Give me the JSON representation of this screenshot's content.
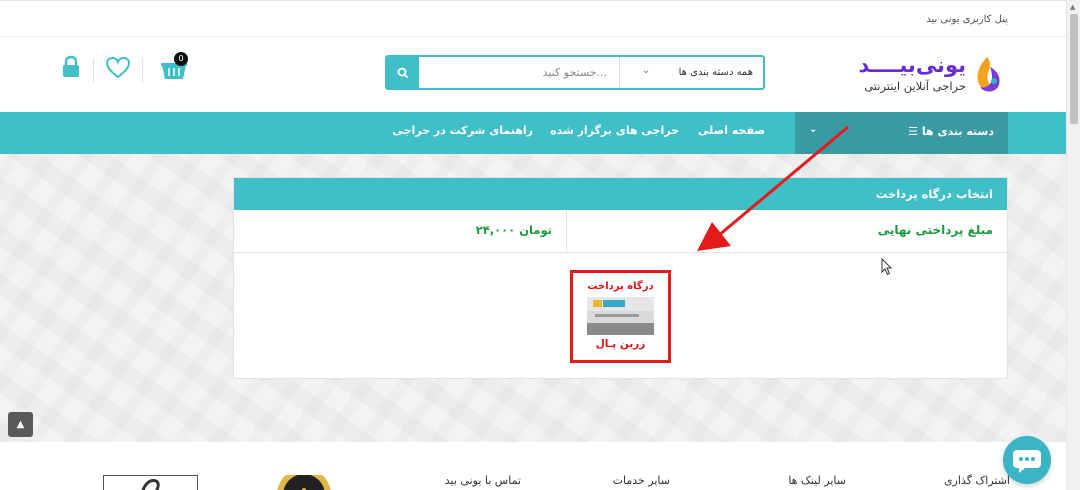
{
  "topbar": {
    "user_panel": "پنل کاربری یونی بید"
  },
  "header": {
    "logo_brand": "یونی‌بیــــد",
    "logo_tagline": "حراجی آنلاین اینترنتی",
    "search": {
      "category": "همه دسته بندی ها",
      "placeholder": "جستجو کنید..."
    },
    "cart_count": "0",
    "icons": [
      "search-icon",
      "cart-icon",
      "heart-icon",
      "lock-icon"
    ]
  },
  "nav": {
    "categories": "دسته بندی ها",
    "links": [
      "صفحه اصلی",
      "حراجی های برگزار شده",
      "راهنمای شرکت در حراجی"
    ]
  },
  "payment": {
    "title": "انتخاب درگاه پرداخت",
    "amount_label": "مبلغ پرداختی نهایی",
    "amount_value": "۲۴,۰۰۰ تومان",
    "gateway_title": "درگاه پرداخت",
    "gateway_name": "زرین پـال"
  },
  "footer": {
    "headings": [
      "اشتراک گذاری",
      "سایر لینک ها",
      "سایر خدمات",
      "تماس با یونی بید"
    ]
  },
  "colors": {
    "accent": "#40bfc9",
    "accent_dark": "#3a9aa4",
    "green": "#1a9a3c",
    "red": "#e41b1b",
    "brand": "#6a2bd6"
  }
}
